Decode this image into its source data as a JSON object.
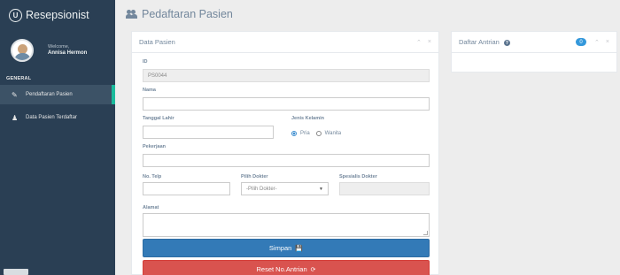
{
  "app": {
    "brand": "Resepsionist"
  },
  "profile": {
    "welcome": "Welcome,",
    "name": "Annisa Hermon"
  },
  "sidebar": {
    "section": "GENERAL",
    "items": [
      {
        "label": "Pendaftaran Pasien",
        "icon": "edit-icon",
        "active": true
      },
      {
        "label": "Data Pasien Terdaftar",
        "icon": "users-icon",
        "active": false
      }
    ]
  },
  "page": {
    "title": "Pedaftaran Pasien"
  },
  "form": {
    "panel_title": "Data Pasien",
    "id_label": "ID",
    "id_value": "PS0044",
    "nama_label": "Nama",
    "nama_value": "",
    "tgl_label": "Tanggal Lahir",
    "jk_label": "Jenis Kelamin",
    "jk_options": [
      "Pria",
      "Wanita"
    ],
    "jk_selected": "Pria",
    "pekerjaan_label": "Pekerjaan",
    "telp_label": "No. Telp",
    "dokter_label": "Pilih Dokter",
    "dokter_placeholder": "-Pilih Dokter-",
    "spesialis_label": "Spesialis Dokter",
    "alamat_label": "Alamat",
    "save_label": "Simpan",
    "reset_label": "Reset No.Antrian"
  },
  "queue": {
    "title": "Daftar Antrian",
    "count": "0"
  },
  "colors": {
    "sidebar": "#2a3f54",
    "accent": "#1abb9c",
    "primary": "#337ab7",
    "danger": "#d9534f"
  }
}
